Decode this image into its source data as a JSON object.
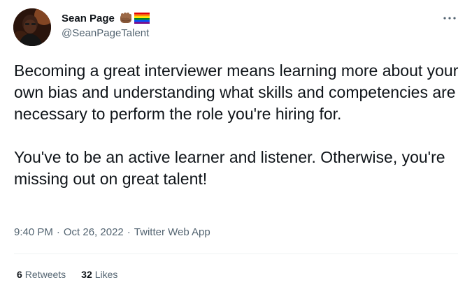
{
  "author": {
    "display_name": "Sean Page",
    "handle": "@SeanPageTalent"
  },
  "tweet": {
    "paragraphs": [
      "Becoming a great interviewer means learning more about your own bias and understanding what skills and competencies are necessary to perform the role you're hiring for.",
      "You've to be an active learner and listener. Otherwise, you're missing out on great talent!"
    ]
  },
  "meta": {
    "time": "9:40 PM",
    "separator": "·",
    "date": "Oct 26, 2022",
    "source": "Twitter Web App"
  },
  "stats": {
    "retweets_count": "6",
    "retweets_label": "Retweets",
    "likes_count": "32",
    "likes_label": "Likes"
  },
  "icons": {
    "name_emojis": [
      "raised-fist-medium-dark-skin",
      "rainbow-flag"
    ],
    "more": "more-icon"
  },
  "colors": {
    "text_primary": "#0f1419",
    "text_secondary": "#536471",
    "divider": "#eff3f4"
  }
}
